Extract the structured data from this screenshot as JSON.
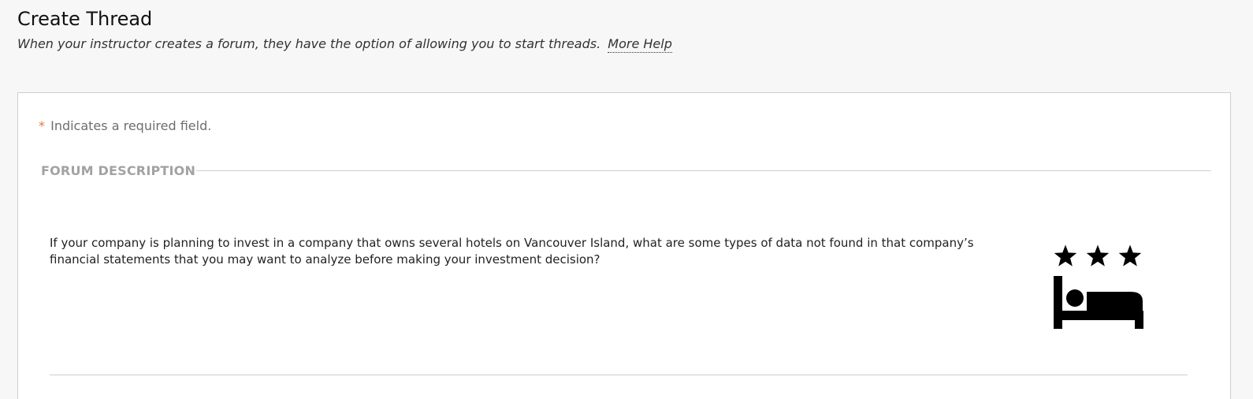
{
  "header": {
    "title": "Create Thread",
    "subtitle": "When your instructor creates a forum, they have the option of allowing you to start threads.",
    "help_link": "More Help"
  },
  "form": {
    "required_star": "*",
    "required_note": "Indicates a required field.",
    "section_heading": "FORUM DESCRIPTION",
    "description": "If your company is planning to invest in a company that owns several hotels on Vancouver Island, what are some types of data not found in that company’s financial statements that you may want to analyze before making your investment decision?",
    "icon": "hotel-three-star-icon"
  }
}
